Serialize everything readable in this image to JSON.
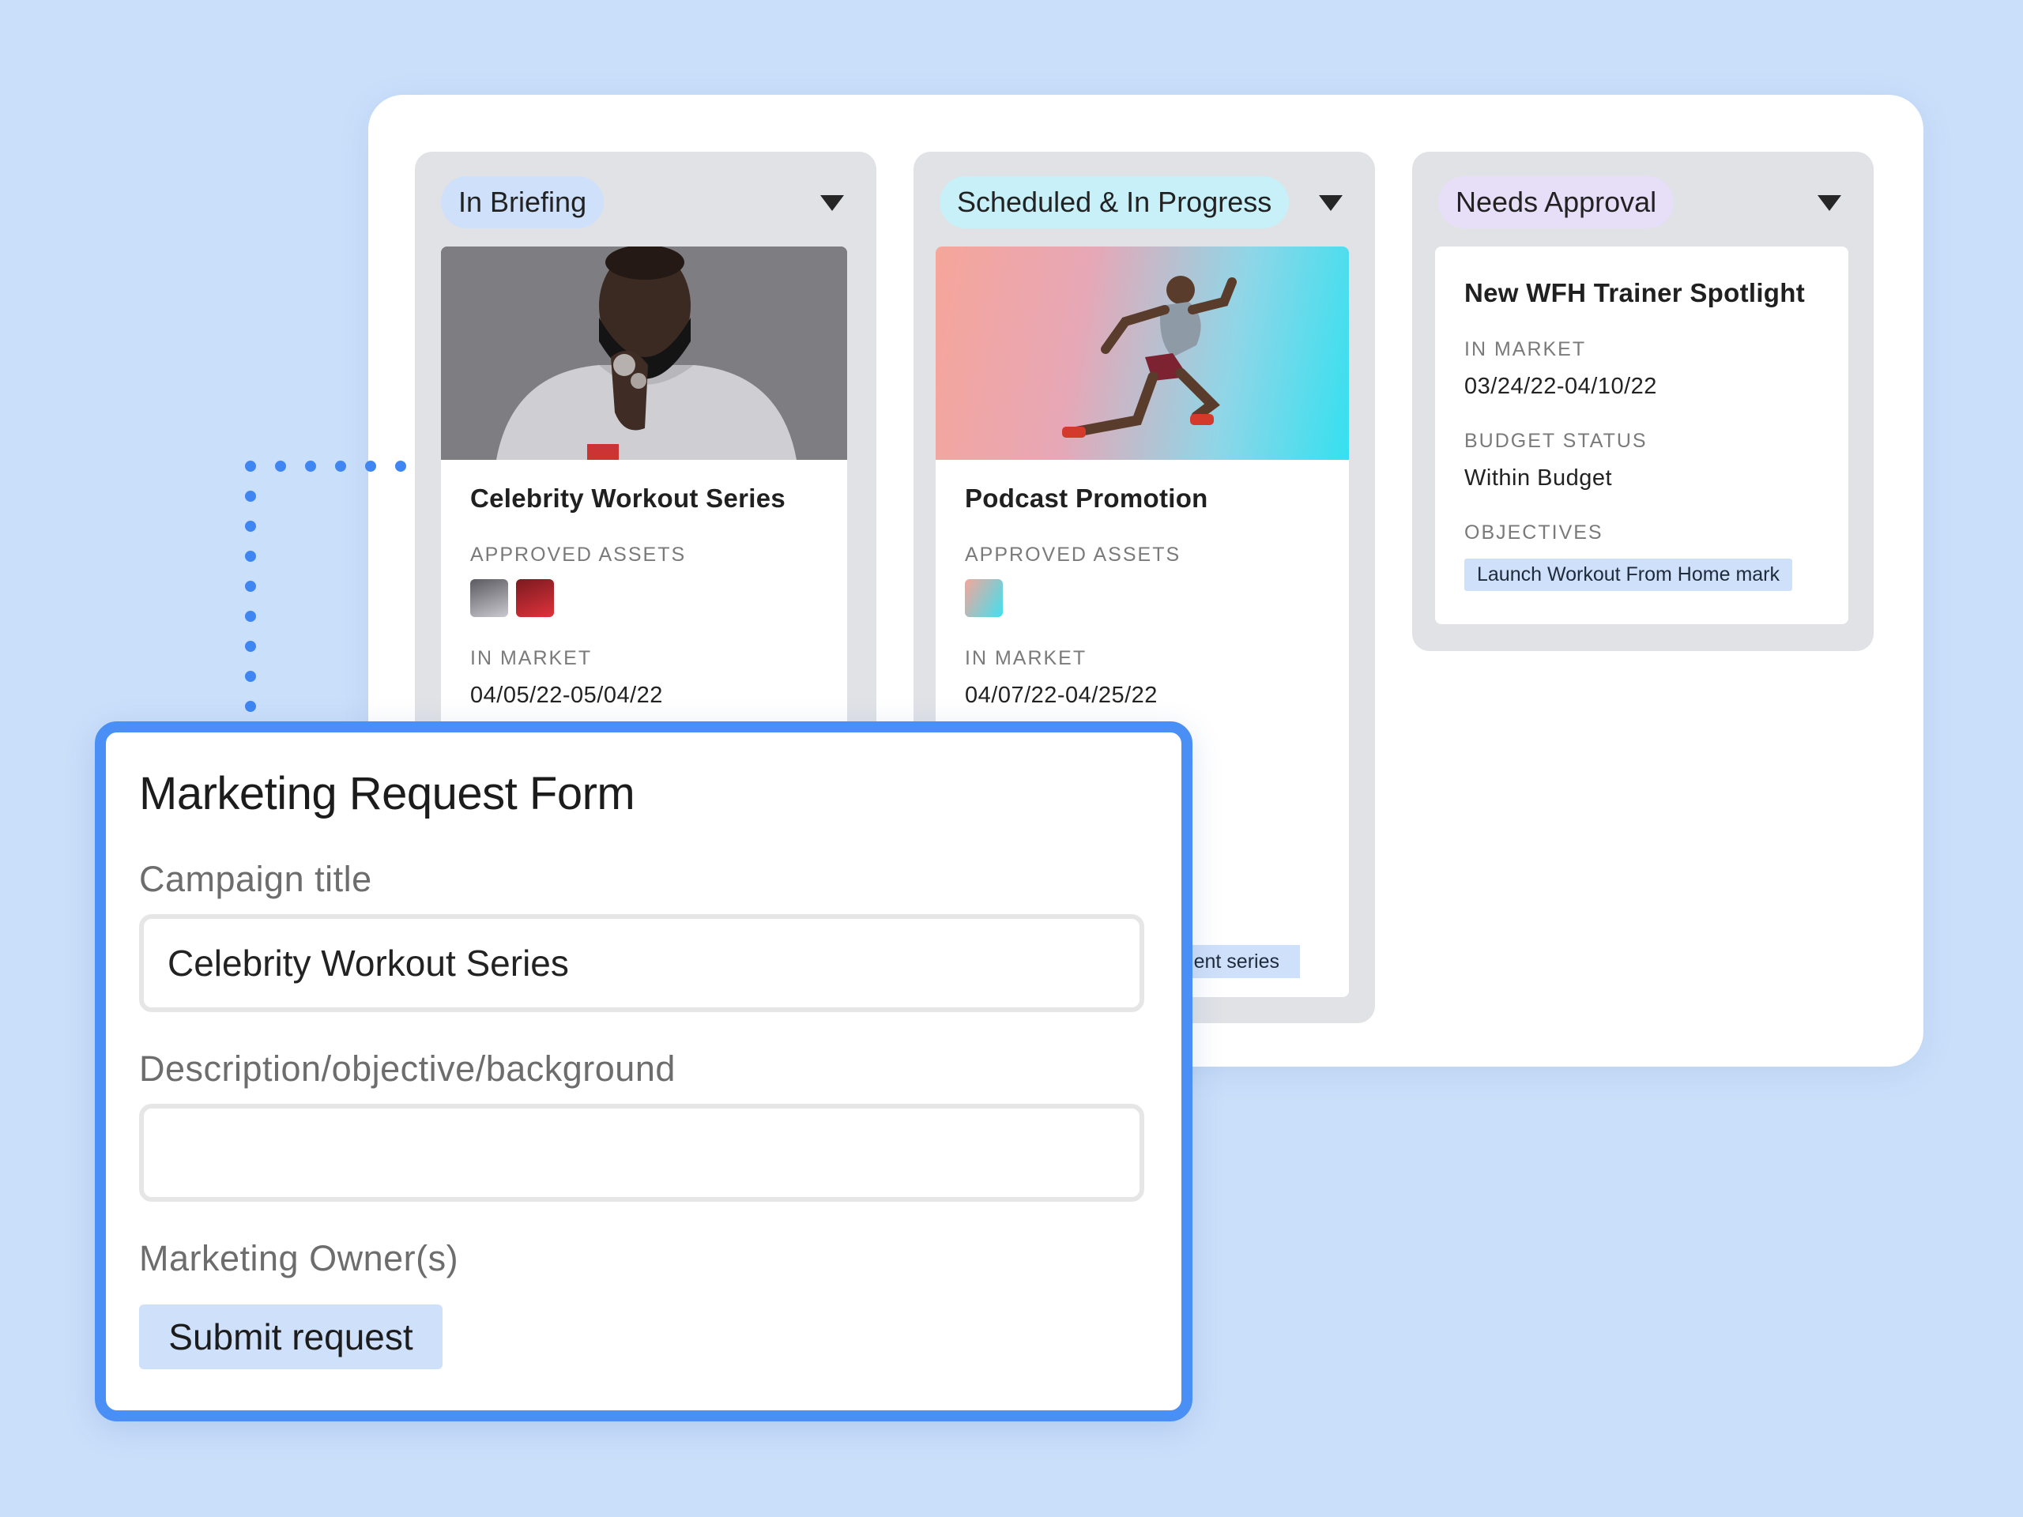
{
  "board": {
    "columns": [
      {
        "title": "In Briefing",
        "pill_color": "#cfe0fa",
        "card": {
          "title": "Celebrity Workout Series",
          "approved_assets_label": "APPROVED ASSETS",
          "in_market_label": "IN MARKET",
          "in_market_value": "04/05/22-05/04/22"
        }
      },
      {
        "title": "Scheduled & In Progress",
        "pill_color": "#c7f0f8",
        "card": {
          "title": "Podcast Promotion",
          "approved_assets_label": "APPROVED ASSETS",
          "in_market_label": "IN MARKET",
          "in_market_value": "04/07/22-04/25/22",
          "partial_chip": "ent series"
        }
      },
      {
        "title": "Needs Approval",
        "pill_color": "#e7def8",
        "card": {
          "title": "New WFH Trainer Spotlight",
          "in_market_label": "IN MARKET",
          "in_market_value": "03/24/22-04/10/22",
          "budget_label": "BUDGET STATUS",
          "budget_value": "Within Budget",
          "objectives_label": "OBJECTIVES",
          "objective_chip": "Launch Workout From Home mark"
        }
      }
    ]
  },
  "form": {
    "title": "Marketing Request Form",
    "campaign_label": "Campaign title",
    "campaign_value": "Celebrity Workout Series",
    "description_label": "Description/objective/background",
    "description_value": "",
    "owner_label": "Marketing Owner(s)",
    "submit_label": "Submit request"
  },
  "colors": {
    "background": "#cadffa",
    "form_border": "#4a8ff5",
    "chip": "#cfe0fa"
  }
}
